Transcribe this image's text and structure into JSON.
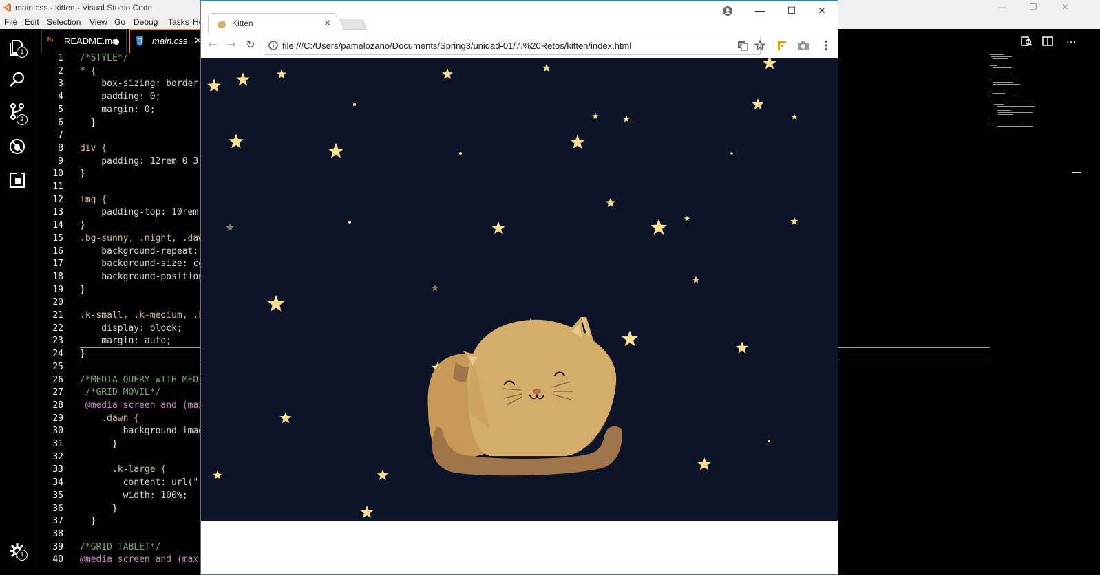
{
  "vscode": {
    "title": "main.css - kitten - Visual Studio Code",
    "menu": [
      "File",
      "Edit",
      "Selection",
      "View",
      "Go",
      "Debug",
      "Tasks",
      "He"
    ],
    "tabs": [
      {
        "label": "README.md",
        "icon": "markdown-icon",
        "dirty": true
      },
      {
        "label": "main.css",
        "icon": "css3-icon",
        "active": true
      }
    ],
    "badges": {
      "explorer": "1",
      "scm": "2",
      "settings": "1"
    },
    "line_numbers": [
      "1",
      "2",
      "3",
      "4",
      "5",
      "6",
      "7",
      "8",
      "9",
      "10",
      "11",
      "12",
      "13",
      "14",
      "15",
      "16",
      "17",
      "18",
      "19",
      "20",
      "21",
      "22",
      "23",
      "24",
      "25",
      "26",
      "27",
      "28",
      "29",
      "30",
      "31",
      "32",
      "33",
      "34",
      "35",
      "36",
      "37",
      "38",
      "39",
      "40"
    ],
    "code_lines": [
      "/*STYLE*/",
      "* {",
      "    box-sizing: border-",
      "    padding: 0;",
      "    margin: 0;",
      "  }",
      "",
      "div {",
      "    padding: 12rem 0 3r",
      "}",
      "",
      "img {",
      "    padding-top: 10rem;",
      "}",
      ".bg-sunny, .night, .daw",
      "    background-repeat: ",
      "    background-size: co",
      "    background-position",
      "}",
      "",
      ".k-small, .k-medium, .k",
      "    display: block;",
      "    margin: auto;",
      "}",
      "",
      "/*MEDIA QUERY WITH MEDI",
      " /*GRID MÓVIL*/",
      " @media screen and (max",
      "    .dawn {",
      "        background-imag",
      "      }",
      "",
      "      .k-large {",
      "        content: url(\".",
      "        width: 100%;",
      "      }",
      "  }",
      "",
      "/*GRID TABLET*/",
      "@media screen and (max-"
    ]
  },
  "chrome": {
    "tab_title": "Kitten",
    "url": "file:///C:/Users/pamelozano/Documents/Spring3/unidad-01/7.%20Retos/kitten/index.html",
    "page_background": "#0d1428",
    "star_color": "#f8e08e",
    "cat_color": "#d4ad6a"
  }
}
